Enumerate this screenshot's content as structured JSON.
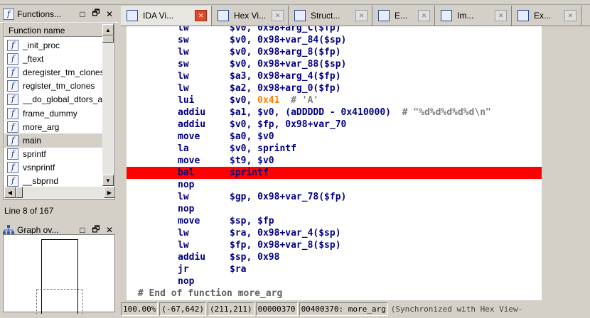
{
  "functions_panel": {
    "title": "Functions...",
    "restore_glyph": "□",
    "float_glyph": "🗗",
    "close_glyph": "✕",
    "column_header": "Function name",
    "icon_glyph": "f",
    "items": [
      {
        "name": "_init_proc"
      },
      {
        "name": "_ftext"
      },
      {
        "name": "deregister_tm_clones"
      },
      {
        "name": "register_tm_clones"
      },
      {
        "name": "__do_global_dtors_a"
      },
      {
        "name": "frame_dummy"
      },
      {
        "name": "more_arg"
      },
      {
        "name": "main"
      },
      {
        "name": "sprintf"
      },
      {
        "name": "vsnprintf"
      },
      {
        "name": "__sbprnd"
      }
    ],
    "selected_index": 7,
    "line_count": "Line 8 of 167"
  },
  "graph_panel": {
    "title": "Graph ov...",
    "restore_glyph": "□",
    "float_glyph": "🗗",
    "close_glyph": "✕"
  },
  "tabs": [
    {
      "label": "IDA Vi...",
      "icon": "IDA",
      "active": true
    },
    {
      "label": "Hex Vi...",
      "icon": "Hex"
    },
    {
      "label": "Struct...",
      "icon": "A"
    },
    {
      "label": "E...",
      "icon": "E"
    },
    {
      "label": "Im...",
      "icon": "Im"
    },
    {
      "label": "Ex...",
      "icon": "Ex"
    }
  ],
  "disasm": [
    {
      "mn": "lw",
      "ops": "$v0, 0x98+arg_C($fp)"
    },
    {
      "mn": "sw",
      "ops": "$v0, 0x98+var_84($sp)"
    },
    {
      "mn": "lw",
      "ops": "$v0, 0x98+arg_8($fp)"
    },
    {
      "mn": "sw",
      "ops": "$v0, 0x98+var_88($sp)"
    },
    {
      "mn": "lw",
      "ops": "$a3, 0x98+arg_4($fp)"
    },
    {
      "mn": "lw",
      "ops": "$a2, 0x98+arg_0($fp)"
    },
    {
      "mn": "lui",
      "ops_a": "$v0, ",
      "ops_b": "0x41",
      "ops_c": "  # 'A'"
    },
    {
      "mn": "addiu",
      "ops": "$a1, $v0, (aDDDDD - 0x410000)",
      "comment": "  # \"%d%d%d%d%d\\n\""
    },
    {
      "mn": "addiu",
      "ops": "$v0, $fp, 0x98+var_70"
    },
    {
      "mn": "move",
      "ops": "$a0, $v0"
    },
    {
      "mn": "la",
      "ops": "$v0, sprintf"
    },
    {
      "mn": "move",
      "ops": "$t9, $v0"
    },
    {
      "mn": "bal",
      "ops": "sprintf",
      "highlight": true
    },
    {
      "mn": "nop",
      "ops": ""
    },
    {
      "mn": "lw",
      "ops": "$gp, 0x98+var_78($fp)"
    },
    {
      "mn": "nop",
      "ops": ""
    },
    {
      "mn": "move",
      "ops": "$sp, $fp"
    },
    {
      "mn": "lw",
      "ops": "$ra, 0x98+var_4($sp)"
    },
    {
      "mn": "lw",
      "ops": "$fp, 0x98+var_8($sp)"
    },
    {
      "mn": "addiu",
      "ops": "$sp, 0x98"
    },
    {
      "mn": "jr",
      "ops": "$ra"
    },
    {
      "mn": "nop",
      "ops": ""
    },
    {
      "end_comment": " # End of function more_arg"
    }
  ],
  "status": {
    "zoom": "100.00%",
    "coord1": "(-67,642)",
    "coord2": "(211,211)",
    "offset": "00000370",
    "address": "00400370: more_arg",
    "sync": "(Synchronized with Hex View-"
  },
  "colors": {
    "highlight": "#ff0000",
    "mnemonic": "#000080",
    "comment": "#808080",
    "char_const": "#ff8000"
  }
}
